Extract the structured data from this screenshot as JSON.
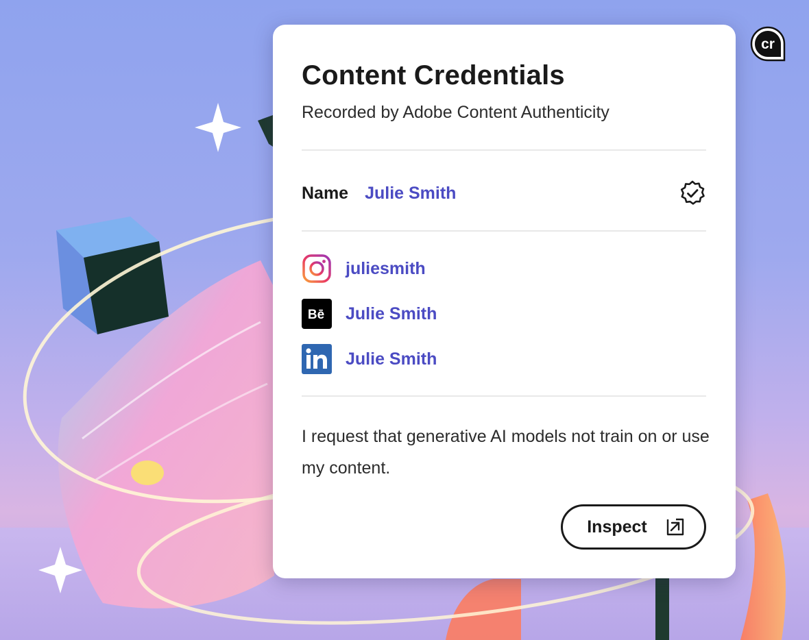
{
  "panel": {
    "title": "Content Credentials",
    "subtitle": "Recorded by Adobe Content Authenticity",
    "name_label": "Name",
    "name_value": "Julie Smith",
    "verified_icon": "verified-badge-icon"
  },
  "social": [
    {
      "network": "Instagram",
      "icon": "instagram-icon",
      "label": "juliesmith"
    },
    {
      "network": "Behance",
      "icon": "behance-icon",
      "label": "Julie Smith"
    },
    {
      "network": "LinkedIn",
      "icon": "linkedin-icon",
      "label": "Julie Smith"
    }
  ],
  "note": "I request that generative AI models not train on or use my content.",
  "inspect": {
    "label": "Inspect",
    "icon": "open-external-icon"
  },
  "badge": {
    "text": "cr",
    "icon": "content-credentials-pin-icon"
  },
  "colors": {
    "link": "#4b4bc3",
    "text": "#1a1a1a",
    "divider": "#e8e8e8",
    "card": "#ffffff"
  }
}
